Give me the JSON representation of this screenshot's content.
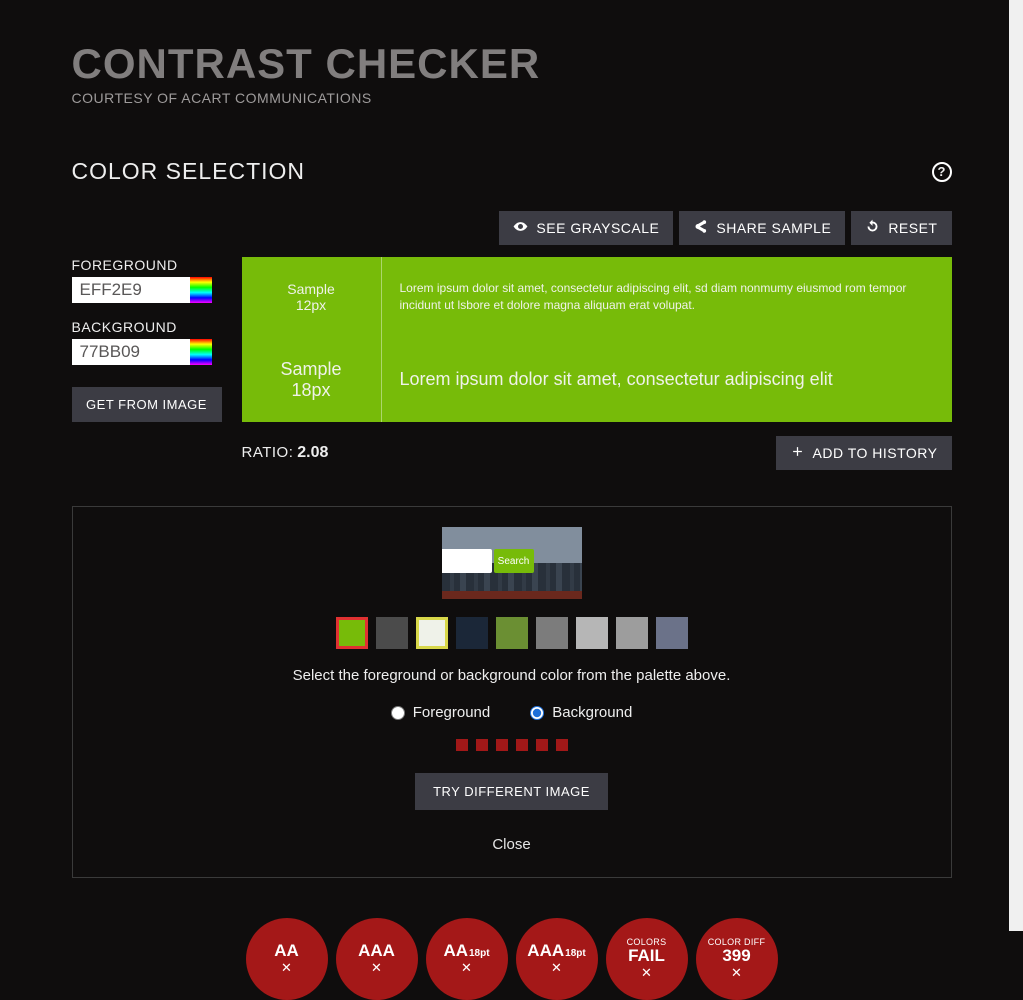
{
  "header": {
    "title": "CONTRAST CHECKER",
    "subtitle": "COURTESY OF ACART COMMUNICATIONS"
  },
  "section_title": "COLOR SELECTION",
  "toolbar": {
    "grayscale": "SEE GRAYSCALE",
    "share": "SHARE SAMPLE",
    "reset": "RESET"
  },
  "inputs": {
    "fg_label": "FOREGROUND",
    "fg_value": "EFF2E9",
    "bg_label": "BACKGROUND",
    "bg_value": "77BB09",
    "from_image": "GET FROM IMAGE"
  },
  "samples": {
    "label_12_a": "Sample",
    "label_12_b": "12px",
    "label_18_a": "Sample",
    "label_18_b": "18px",
    "text_12": "Lorem ipsum dolor sit amet, consectetur adipiscing elit, sd diam nonmumy eiusmod rom tempor incidunt ut lsbore et dolore magna aliquam erat volupat.",
    "text_18": "Lorem ipsum dolor sit amet, consectetur adipiscing elit"
  },
  "ratio": {
    "label": "RATIO:",
    "value": "2.08"
  },
  "history_btn": "ADD TO HISTORY",
  "image_panel": {
    "search_label": "Search",
    "palette": [
      {
        "hex": "#77bb09",
        "sel": "bg"
      },
      {
        "hex": "#4b4b4b",
        "sel": ""
      },
      {
        "hex": "#eff2e9",
        "sel": "fg"
      },
      {
        "hex": "#1b2738",
        "sel": ""
      },
      {
        "hex": "#6b8f33",
        "sel": ""
      },
      {
        "hex": "#7c7c7c",
        "sel": ""
      },
      {
        "hex": "#b6b6b6",
        "sel": ""
      },
      {
        "hex": "#9d9d9d",
        "sel": ""
      },
      {
        "hex": "#6b7289",
        "sel": ""
      }
    ],
    "hint": "Select the foreground or background color from the palette above.",
    "radio_fg": "Foreground",
    "radio_bg": "Background",
    "radio_selected": "bg",
    "try_btn": "TRY DIFFERENT IMAGE",
    "close": "Close",
    "dot_count": 6
  },
  "results": [
    {
      "top": "",
      "main": "AA",
      "suffix": "",
      "status": "fail"
    },
    {
      "top": "",
      "main": "AAA",
      "suffix": "",
      "status": "fail"
    },
    {
      "top": "",
      "main": "AA",
      "suffix": "18pt",
      "status": "fail"
    },
    {
      "top": "",
      "main": "AAA",
      "suffix": "18pt",
      "status": "fail"
    },
    {
      "top": "COLORS",
      "main": "FAIL",
      "suffix": "",
      "status": "fail"
    },
    {
      "top": "COLOR DIFF",
      "main": "399",
      "suffix": "",
      "status": "fail"
    }
  ]
}
